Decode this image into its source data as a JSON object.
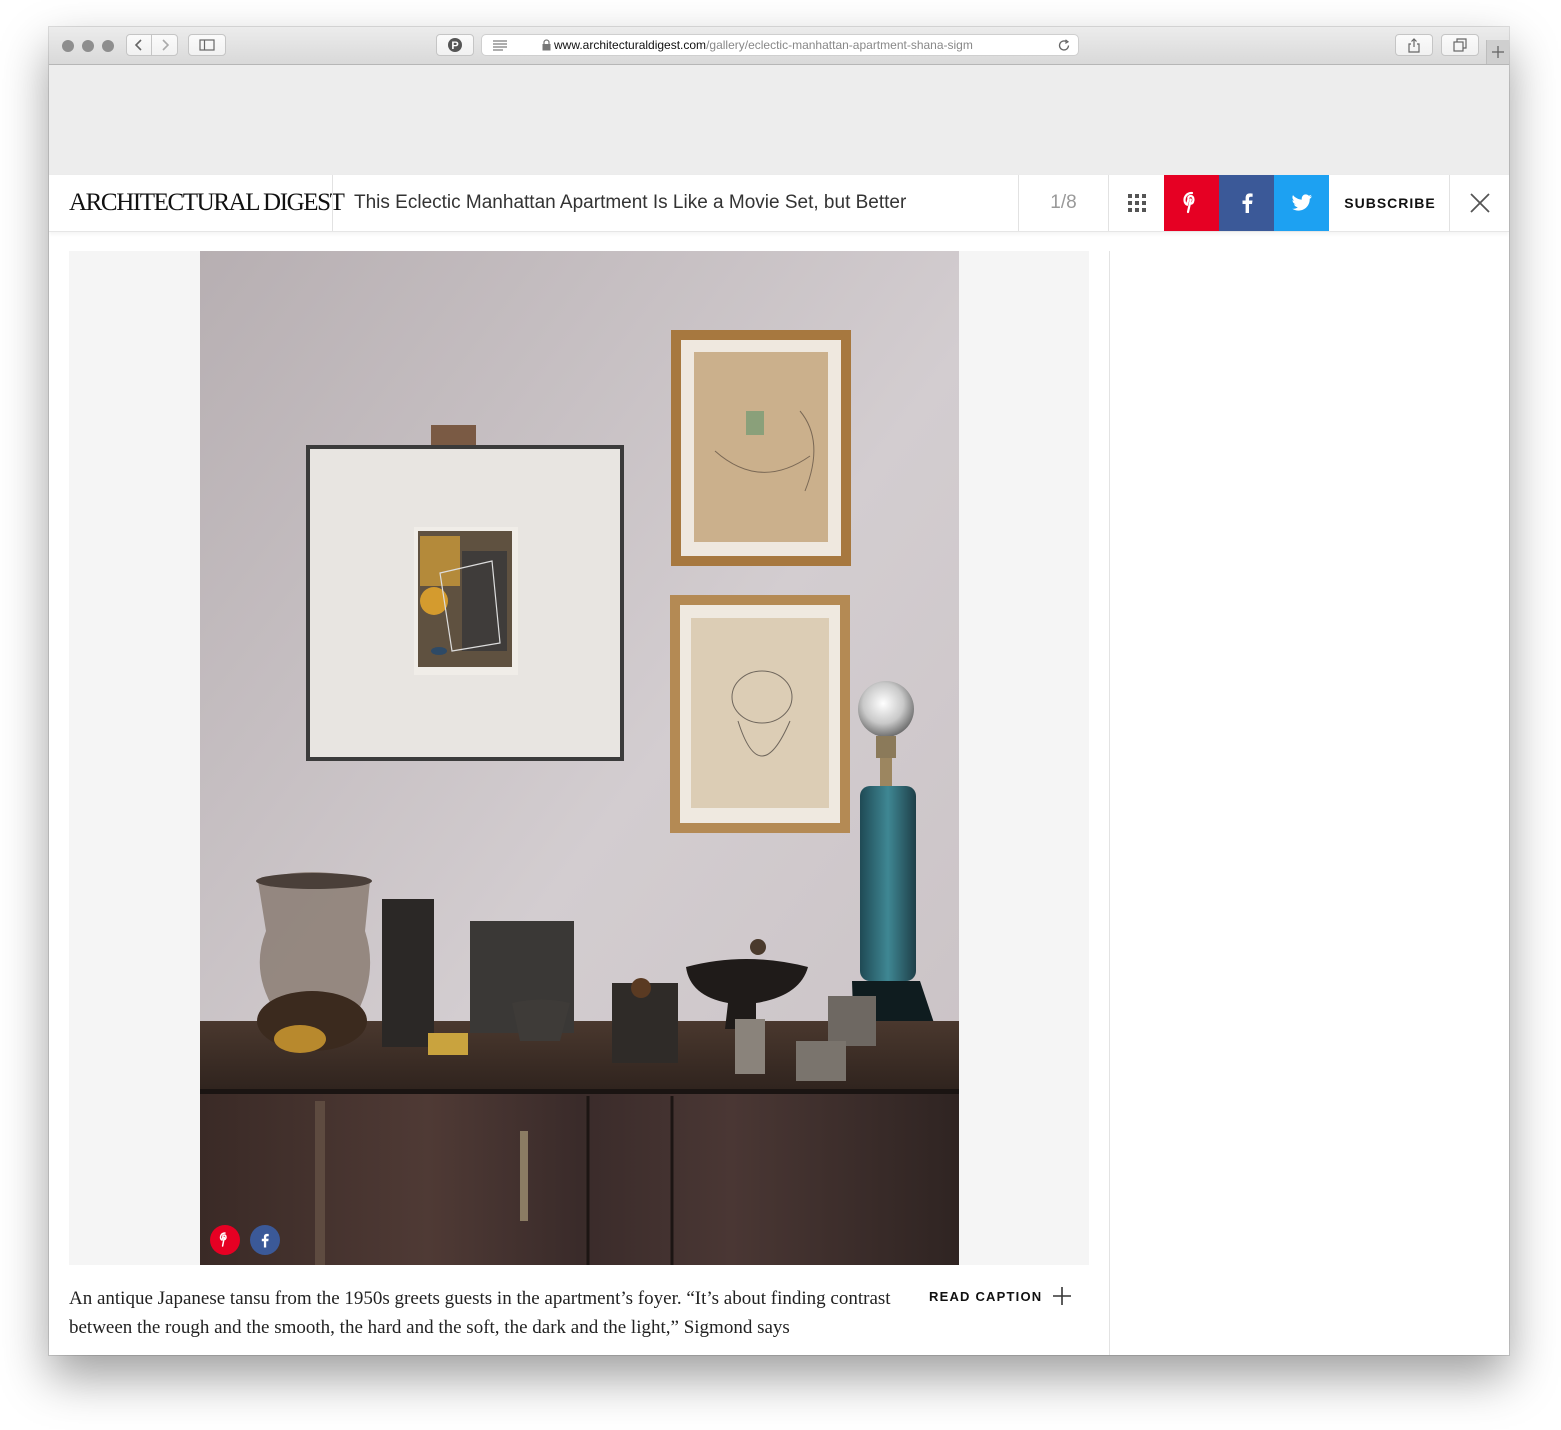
{
  "browser": {
    "url_domain": "www.architecturaldigest.com",
    "url_path": "/gallery/eclectic-manhattan-apartment-shana-sigm"
  },
  "gallery_header": {
    "logo": "ARCHITECTURAL DIGEST",
    "title": "This Eclectic Manhattan Apartment Is Like a Movie Set, but Better",
    "counter": "1/8",
    "subscribe_label": "SUBSCRIBE"
  },
  "caption": {
    "text": "An antique Japanese tansu from the 1950s greets guests in the apartment’s foyer. “It’s about finding contrast between the rough and the smooth, the hard and the soft, the dark and the light,” Sigmond says",
    "read_caption_label": "READ CAPTION"
  },
  "colors": {
    "pinterest": "#e60023",
    "facebook": "#3b5998",
    "twitter": "#1da1f2"
  },
  "icons": [
    "grid-icon",
    "pinterest-icon",
    "facebook-icon",
    "twitter-icon",
    "close-icon",
    "plus-icon",
    "lock-icon",
    "reload-icon",
    "share-icon",
    "tabs-icon",
    "sidebar-icon",
    "reader-icon"
  ]
}
